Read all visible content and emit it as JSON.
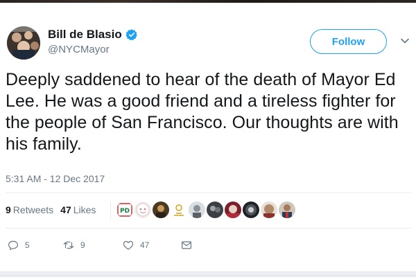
{
  "author": {
    "display_name": "Bill de Blasio",
    "handle": "@NYCMayor",
    "verified": true
  },
  "follow_button": {
    "label": "Follow"
  },
  "tweet": {
    "text": "Deeply saddened to hear of the death of Mayor Ed Lee. He was a good friend and a tireless fighter for the people of San Francisco. Our thoughts are with his family.",
    "timestamp": "5:31 AM - 12 Dec 2017"
  },
  "stats": {
    "retweets": {
      "count": "9",
      "label": "Retweets"
    },
    "likes": {
      "count": "47",
      "label": "Likes"
    }
  },
  "actions": {
    "reply": {
      "count": "5",
      "icon": "reply-icon"
    },
    "retweet": {
      "count": "9",
      "icon": "retweet-icon"
    },
    "like": {
      "count": "47",
      "icon": "heart-icon"
    },
    "direct_message": {
      "icon": "envelope-icon"
    }
  },
  "colors": {
    "accent": "#1da1f2",
    "text": "#14171a",
    "muted": "#657786",
    "divider": "#e6ecf0"
  }
}
